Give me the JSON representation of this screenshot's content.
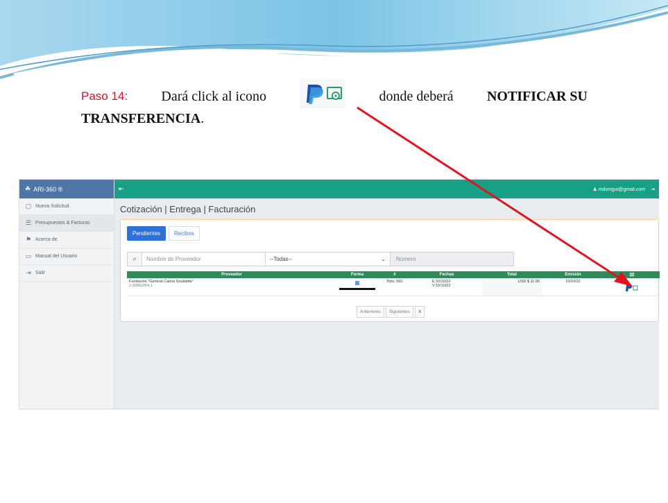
{
  "instruction": {
    "step_label": "Paso 14:",
    "text_before_icon": "Dará click al icono",
    "text_after_icon": "donde deberá",
    "emphasis_1": "NOTIFICAR SU",
    "emphasis_2": "TRANSFERENCIA",
    "end": "."
  },
  "app": {
    "brand": "ARI-360 ®",
    "user_email": "mdvmgui@gmail.com",
    "sidebar": {
      "items": [
        {
          "label": "Nueva Solicitud",
          "icon": "file-icon"
        },
        {
          "label": "Presupuestos & Facturas",
          "icon": "list-icon"
        },
        {
          "label": "Acerca de",
          "icon": "flag-icon"
        },
        {
          "label": "Manual del Usuario",
          "icon": "book-icon"
        },
        {
          "label": "Salir",
          "icon": "logout-icon"
        }
      ]
    },
    "page_title": "Cotización | Entrega | Facturación",
    "tabs": [
      "Pendientes",
      "Recibos"
    ],
    "filters": {
      "provider_placeholder": "Nombre de Proveedor",
      "select_value": "--Todas--",
      "number_placeholder": "Número"
    },
    "table": {
      "headers": [
        "Proveedor",
        "Forma",
        "#",
        "Fechas",
        "Total",
        "Emisión",
        "icon"
      ],
      "row": {
        "provider": "Fundación \"General Carlos Soublette\"",
        "provider_id": "J-30862054-1",
        "number": "Pptv. 560",
        "date_e": "E:10/10/22",
        "date_v": "V:15/10/22",
        "total": "USD $ 11.00",
        "emission": "10/10/22"
      }
    },
    "pager": [
      "Anteriores",
      "Siguientes",
      "X"
    ]
  },
  "colors": {
    "step_red": "#d0102a",
    "topbar_green": "#17a085",
    "table_header_green": "#2f8a5a",
    "brand_blue": "#4e77a8",
    "tab_blue": "#2f6fd8",
    "arrow_red": "#e0141e"
  }
}
